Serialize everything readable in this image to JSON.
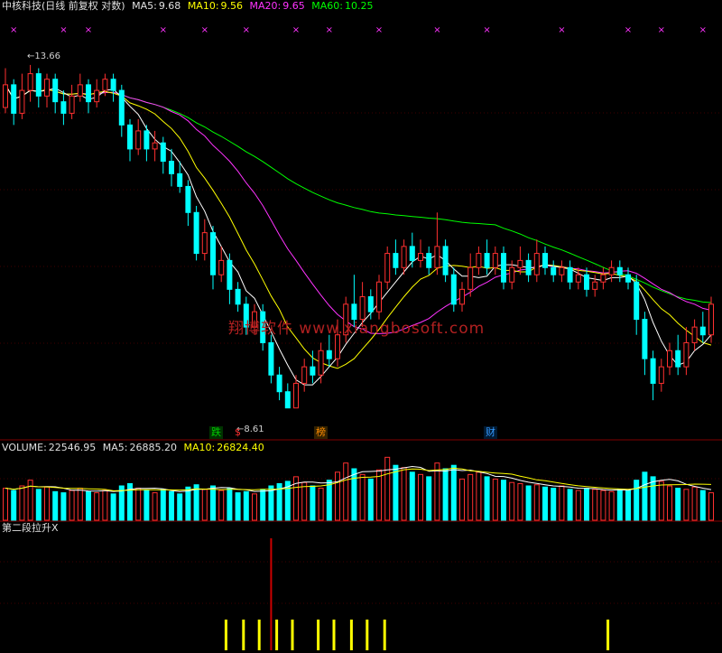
{
  "header": {
    "stock": "中核科技(日线 前复权 对数)",
    "ma5_label": "MA5:",
    "ma5_value": "9.68",
    "ma10_label": "MA10:",
    "ma10_value": "9.56",
    "ma20_label": "MA20:",
    "ma20_value": "9.65",
    "ma60_label": "MA60:",
    "ma60_value": "10.25"
  },
  "volume_header": {
    "label": "VOLUME:",
    "value": "22546.95",
    "ma5_label": "MA5:",
    "ma5_value": "26885.20",
    "ma10_label": "MA10:",
    "ma10_value": "26824.40"
  },
  "indicator_header": {
    "label": "第二段拉升X"
  },
  "watermark": "翔博软件 www.xiangbosoft.com",
  "price_labels": {
    "high": "13.66",
    "low": "8.61"
  },
  "event_tags": [
    {
      "text": "跌",
      "color": "#00cc00"
    },
    {
      "text": "$",
      "color": "#ff3030"
    },
    {
      "text": "榜",
      "color": "#ff8c00"
    },
    {
      "text": "财",
      "color": "#3399ff"
    }
  ],
  "colors": {
    "up": "#ff3030",
    "down": "#00ffff",
    "ma5": "#ffffff",
    "ma10": "#ffff00",
    "ma20": "#ff33ff",
    "ma60": "#00ff00",
    "grid": "#800000",
    "signal": "#ffff00",
    "vline": "#cc0000",
    "marker": "#ff33ff"
  },
  "chart_data": {
    "type": "candlestick",
    "title": "中核科技(日线 前复权 对数)",
    "candles": [
      [
        12.9,
        13.3,
        13.6,
        12.8
      ],
      [
        13.3,
        12.8,
        13.4,
        12.6
      ],
      [
        12.8,
        13.2,
        13.5,
        12.7
      ],
      [
        13.2,
        13.5,
        13.66,
        13.0
      ],
      [
        13.5,
        13.1,
        13.6,
        12.9
      ],
      [
        13.1,
        13.4,
        13.5,
        12.9
      ],
      [
        13.4,
        13.0,
        13.5,
        12.8
      ],
      [
        13.0,
        12.8,
        13.2,
        12.6
      ],
      [
        12.8,
        13.1,
        13.3,
        12.7
      ],
      [
        13.1,
        13.3,
        13.5,
        13.0
      ],
      [
        13.3,
        13.0,
        13.4,
        12.8
      ],
      [
        13.0,
        13.2,
        13.4,
        12.9
      ],
      [
        13.2,
        13.4,
        13.5,
        13.1
      ],
      [
        13.4,
        13.2,
        13.5,
        13.0
      ],
      [
        13.2,
        12.6,
        13.3,
        12.4
      ],
      [
        12.6,
        12.2,
        12.7,
        12.0
      ],
      [
        12.2,
        12.5,
        12.7,
        12.1
      ],
      [
        12.5,
        12.2,
        12.6,
        12.0
      ],
      [
        12.2,
        12.3,
        12.5,
        12.0
      ],
      [
        12.3,
        12.0,
        12.4,
        11.8
      ],
      [
        12.0,
        11.8,
        12.2,
        11.6
      ],
      [
        11.8,
        11.6,
        12.0,
        11.5
      ],
      [
        11.6,
        11.2,
        11.7,
        11.0
      ],
      [
        11.2,
        10.6,
        11.3,
        10.5
      ],
      [
        10.6,
        10.9,
        11.1,
        10.5
      ],
      [
        10.9,
        10.3,
        11.0,
        10.1
      ],
      [
        10.3,
        10.5,
        10.7,
        10.2
      ],
      [
        10.5,
        10.1,
        10.6,
        9.9
      ],
      [
        10.1,
        9.9,
        10.2,
        9.8
      ],
      [
        9.9,
        9.6,
        10.0,
        9.5
      ],
      [
        9.6,
        9.8,
        9.9,
        9.5
      ],
      [
        9.8,
        9.4,
        9.9,
        9.3
      ],
      [
        9.4,
        9.0,
        9.5,
        8.9
      ],
      [
        9.0,
        8.8,
        9.1,
        8.7
      ],
      [
        8.8,
        8.61,
        8.9,
        8.61
      ],
      [
        8.61,
        8.9,
        9.0,
        8.61
      ],
      [
        8.9,
        9.1,
        9.2,
        8.8
      ],
      [
        9.1,
        9.0,
        9.3,
        8.9
      ],
      [
        9.0,
        9.3,
        9.4,
        8.9
      ],
      [
        9.3,
        9.2,
        9.5,
        9.1
      ],
      [
        9.2,
        9.5,
        9.7,
        9.1
      ],
      [
        9.5,
        9.9,
        10.0,
        9.4
      ],
      [
        9.9,
        9.7,
        10.3,
        9.6
      ],
      [
        9.7,
        10.0,
        10.2,
        9.6
      ],
      [
        10.0,
        9.8,
        10.1,
        9.7
      ],
      [
        9.8,
        10.2,
        10.3,
        9.7
      ],
      [
        10.2,
        10.6,
        10.7,
        10.1
      ],
      [
        10.6,
        10.4,
        10.8,
        10.3
      ],
      [
        10.4,
        10.7,
        10.8,
        10.3
      ],
      [
        10.7,
        10.5,
        10.9,
        10.4
      ],
      [
        10.5,
        10.6,
        10.8,
        10.4
      ],
      [
        10.6,
        10.4,
        10.7,
        10.3
      ],
      [
        10.4,
        10.7,
        11.2,
        10.3
      ],
      [
        10.7,
        10.3,
        10.8,
        10.2
      ],
      [
        10.3,
        9.9,
        10.4,
        9.8
      ],
      [
        9.9,
        10.1,
        10.2,
        9.8
      ],
      [
        10.1,
        10.4,
        10.6,
        10.0
      ],
      [
        10.4,
        10.6,
        10.7,
        10.3
      ],
      [
        10.6,
        10.4,
        10.8,
        10.3
      ],
      [
        10.4,
        10.6,
        10.7,
        10.3
      ],
      [
        10.6,
        10.2,
        10.7,
        10.1
      ],
      [
        10.2,
        10.4,
        10.5,
        10.1
      ],
      [
        10.4,
        10.5,
        10.7,
        10.3
      ],
      [
        10.5,
        10.3,
        10.6,
        10.2
      ],
      [
        10.3,
        10.6,
        10.8,
        10.2
      ],
      [
        10.6,
        10.4,
        10.7,
        10.3
      ],
      [
        10.4,
        10.3,
        10.5,
        10.2
      ],
      [
        10.3,
        10.4,
        10.5,
        10.2
      ],
      [
        10.4,
        10.2,
        10.5,
        10.1
      ],
      [
        10.2,
        10.3,
        10.4,
        10.1
      ],
      [
        10.3,
        10.1,
        10.4,
        10.0
      ],
      [
        10.1,
        10.2,
        10.3,
        10.0
      ],
      [
        10.2,
        10.3,
        10.4,
        10.1
      ],
      [
        10.3,
        10.4,
        10.5,
        10.2
      ],
      [
        10.4,
        10.3,
        10.5,
        10.2
      ],
      [
        10.3,
        10.2,
        10.4,
        10.1
      ],
      [
        10.2,
        9.7,
        10.3,
        9.5
      ],
      [
        9.7,
        9.2,
        9.8,
        9.0
      ],
      [
        9.2,
        8.9,
        9.3,
        8.7
      ],
      [
        8.9,
        9.1,
        9.2,
        8.8
      ],
      [
        9.1,
        9.3,
        9.4,
        9.0
      ],
      [
        9.3,
        9.1,
        9.5,
        9.0
      ],
      [
        9.1,
        9.4,
        9.6,
        9.0
      ],
      [
        9.4,
        9.6,
        9.7,
        9.3
      ],
      [
        9.6,
        9.5,
        9.8,
        9.4
      ],
      [
        9.5,
        9.9,
        10.0,
        9.4
      ]
    ],
    "volume": [
      28,
      26,
      30,
      35,
      27,
      29,
      25,
      24,
      26,
      28,
      25,
      24,
      26,
      23,
      30,
      32,
      28,
      26,
      24,
      27,
      25,
      23,
      29,
      31,
      27,
      30,
      26,
      28,
      24,
      25,
      23,
      27,
      30,
      32,
      34,
      38,
      33,
      30,
      28,
      35,
      42,
      50,
      45,
      40,
      36,
      44,
      55,
      48,
      46,
      42,
      40,
      38,
      50,
      45,
      48,
      36,
      40,
      42,
      38,
      36,
      35,
      33,
      32,
      30,
      31,
      29,
      28,
      30,
      27,
      26,
      28,
      27,
      26,
      25,
      27,
      26,
      35,
      42,
      38,
      34,
      30,
      28,
      27,
      29,
      26,
      24
    ],
    "indicator_signals": [
      27,
      29,
      31,
      33,
      35,
      38,
      40,
      42,
      44,
      46,
      73
    ],
    "marker_positions": [
      1,
      7,
      10,
      19,
      24,
      29,
      35,
      39,
      45,
      52,
      58,
      67,
      75,
      79,
      84
    ]
  }
}
